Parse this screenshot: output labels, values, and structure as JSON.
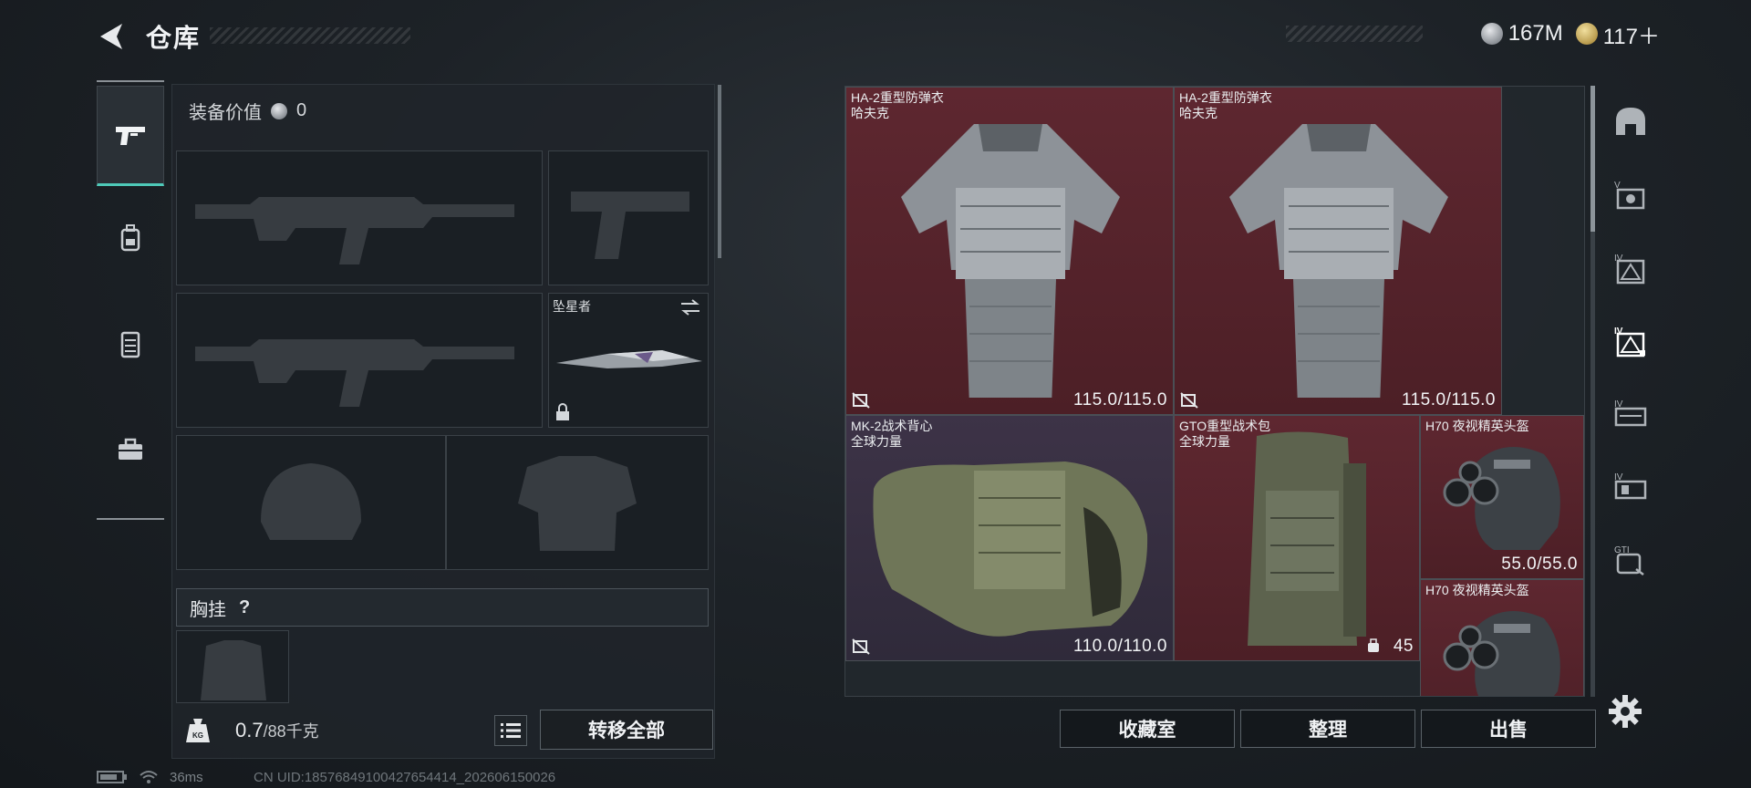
{
  "header": {
    "title": "仓库",
    "currencies": [
      {
        "icon": "silver-coin-icon",
        "value": "167M"
      },
      {
        "icon": "gold-coin-icon",
        "value": "117＋"
      }
    ]
  },
  "left_nav": {
    "items": [
      {
        "icon": "pistol-icon",
        "active": true
      },
      {
        "icon": "backpack-icon",
        "active": false
      },
      {
        "icon": "vest-icon",
        "active": false
      },
      {
        "icon": "toolbox-icon",
        "active": false
      }
    ]
  },
  "equipment": {
    "value_label": "装备价值",
    "value_amount": "0",
    "melee_slot_label": "坠星者",
    "chest_rig_label": "胸挂",
    "chest_rig_help": "?",
    "weight_value": "0.7",
    "weight_max": "/88千克",
    "weight_icon_text": "KG",
    "transfer_all_label": "转移全部"
  },
  "storage": {
    "items": [
      {
        "name": "HA-2重型防弹衣\n哈夫克",
        "durability": "115.0/115.0",
        "rarity": "red"
      },
      {
        "name": "HA-2重型防弹衣\n哈夫克",
        "durability": "115.0/115.0",
        "rarity": "red"
      },
      {
        "name": "MK-2战术背心\n全球力量",
        "durability": "110.0/110.0",
        "rarity": "purple"
      },
      {
        "name": "GTO重型战术包\n全球力量",
        "capacity": "45",
        "rarity": "red"
      },
      {
        "name": "H70 夜视精英头盔",
        "durability": "55.0/55.0",
        "rarity": "red"
      },
      {
        "name": "H70 夜视精英头盔",
        "rarity": "red"
      }
    ]
  },
  "filter_rail": [
    {
      "icon": "helmet-filter-icon",
      "label": ""
    },
    {
      "icon": "armor-v-filter-icon",
      "label": "V"
    },
    {
      "icon": "armor-iv-filter-icon",
      "label": "IV"
    },
    {
      "icon": "armor-iv-selected-filter-icon",
      "label": "IV"
    },
    {
      "icon": "rig-iv-filter-icon",
      "label": "IV"
    },
    {
      "icon": "rig-iv-2-filter-icon",
      "label": "IV"
    },
    {
      "icon": "gti-filter-icon",
      "label": "GTI"
    }
  ],
  "actions": {
    "collection_room": "收藏室",
    "organize": "整理",
    "sell": "出售"
  },
  "status": {
    "ping": "36ms",
    "uid": "CN UID:18576849100427654414_202606150026"
  },
  "colors": {
    "accent": "#4ec9b8",
    "rarity_red": "#5e2730",
    "rarity_purple": "#3d3347"
  }
}
